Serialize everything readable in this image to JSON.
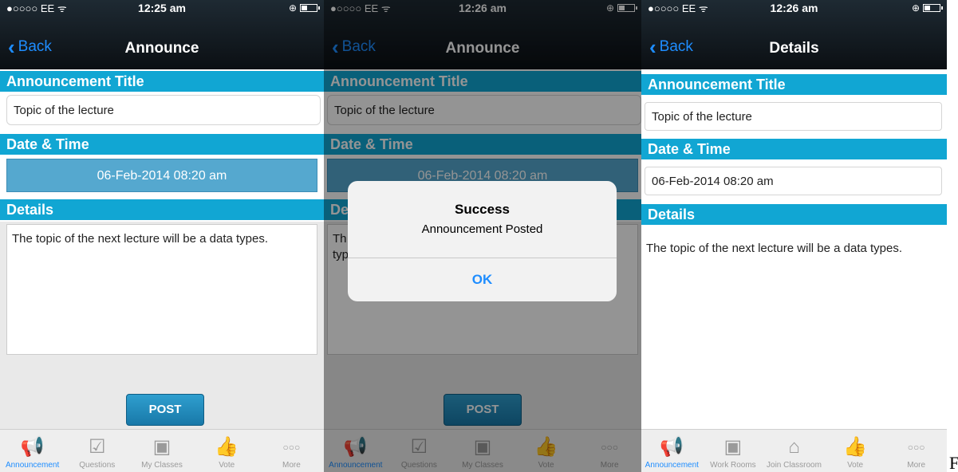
{
  "status_bar": [
    {
      "carrier": "●○○○○ EE ᯤ",
      "time": "12:25 am"
    },
    {
      "carrier": "●○○○○ EE ᯤ",
      "time": "12:26 am"
    },
    {
      "carrier": "●○○○○ EE ᯤ",
      "time": "12:26 am"
    }
  ],
  "screen1": {
    "back_label": "Back",
    "title": "Announce",
    "section_title": "Announcement Title",
    "title_value": "Topic of the lecture",
    "section_date": "Date & Time",
    "date_value": "06-Feb-2014 08:20 am",
    "section_details": "Details",
    "details_value": "The topic of the next lecture will be a data types.",
    "post_label": "POST",
    "tabs": [
      "Announcement",
      "Questions",
      "My Classes",
      "Vote",
      "More"
    ]
  },
  "screen2": {
    "back_label": "Back",
    "title": "Announce",
    "section_title": "Announcement Title",
    "title_value": "Topic of the lecture",
    "section_date": "Date & Time",
    "date_value": "06-Feb-2014 08:20 am",
    "section_details": "Details",
    "details_partial_1": "Th",
    "details_partial_2": "typ",
    "post_label": "POST",
    "tabs": [
      "Announcement",
      "Questions",
      "My Classes",
      "Vote",
      "More"
    ],
    "alert": {
      "title": "Success",
      "message": "Announcement Posted",
      "ok": "OK"
    }
  },
  "screen3": {
    "back_label": "Back",
    "title": "Details",
    "section_title": "Announcement Title",
    "title_value": "Topic of the lecture",
    "section_date": "Date & Time",
    "date_value": "06-Feb-2014 08:20 am",
    "section_details": "Details",
    "details_value": "The topic of the next lecture will be a data types.",
    "tabs": [
      "Announcement",
      "Work Rooms",
      "Join Classroom",
      "Vote",
      "More"
    ]
  },
  "stray_char": "F",
  "colors": {
    "accent": "#1e8dff",
    "section": "#11a6d3",
    "nav": "#0b0f13"
  },
  "icons": [
    "megaphone-icon",
    "checkbox-icon",
    "presentation-board-icon",
    "thumbs-up-icon",
    "more-dots-icon",
    "house-icon"
  ]
}
